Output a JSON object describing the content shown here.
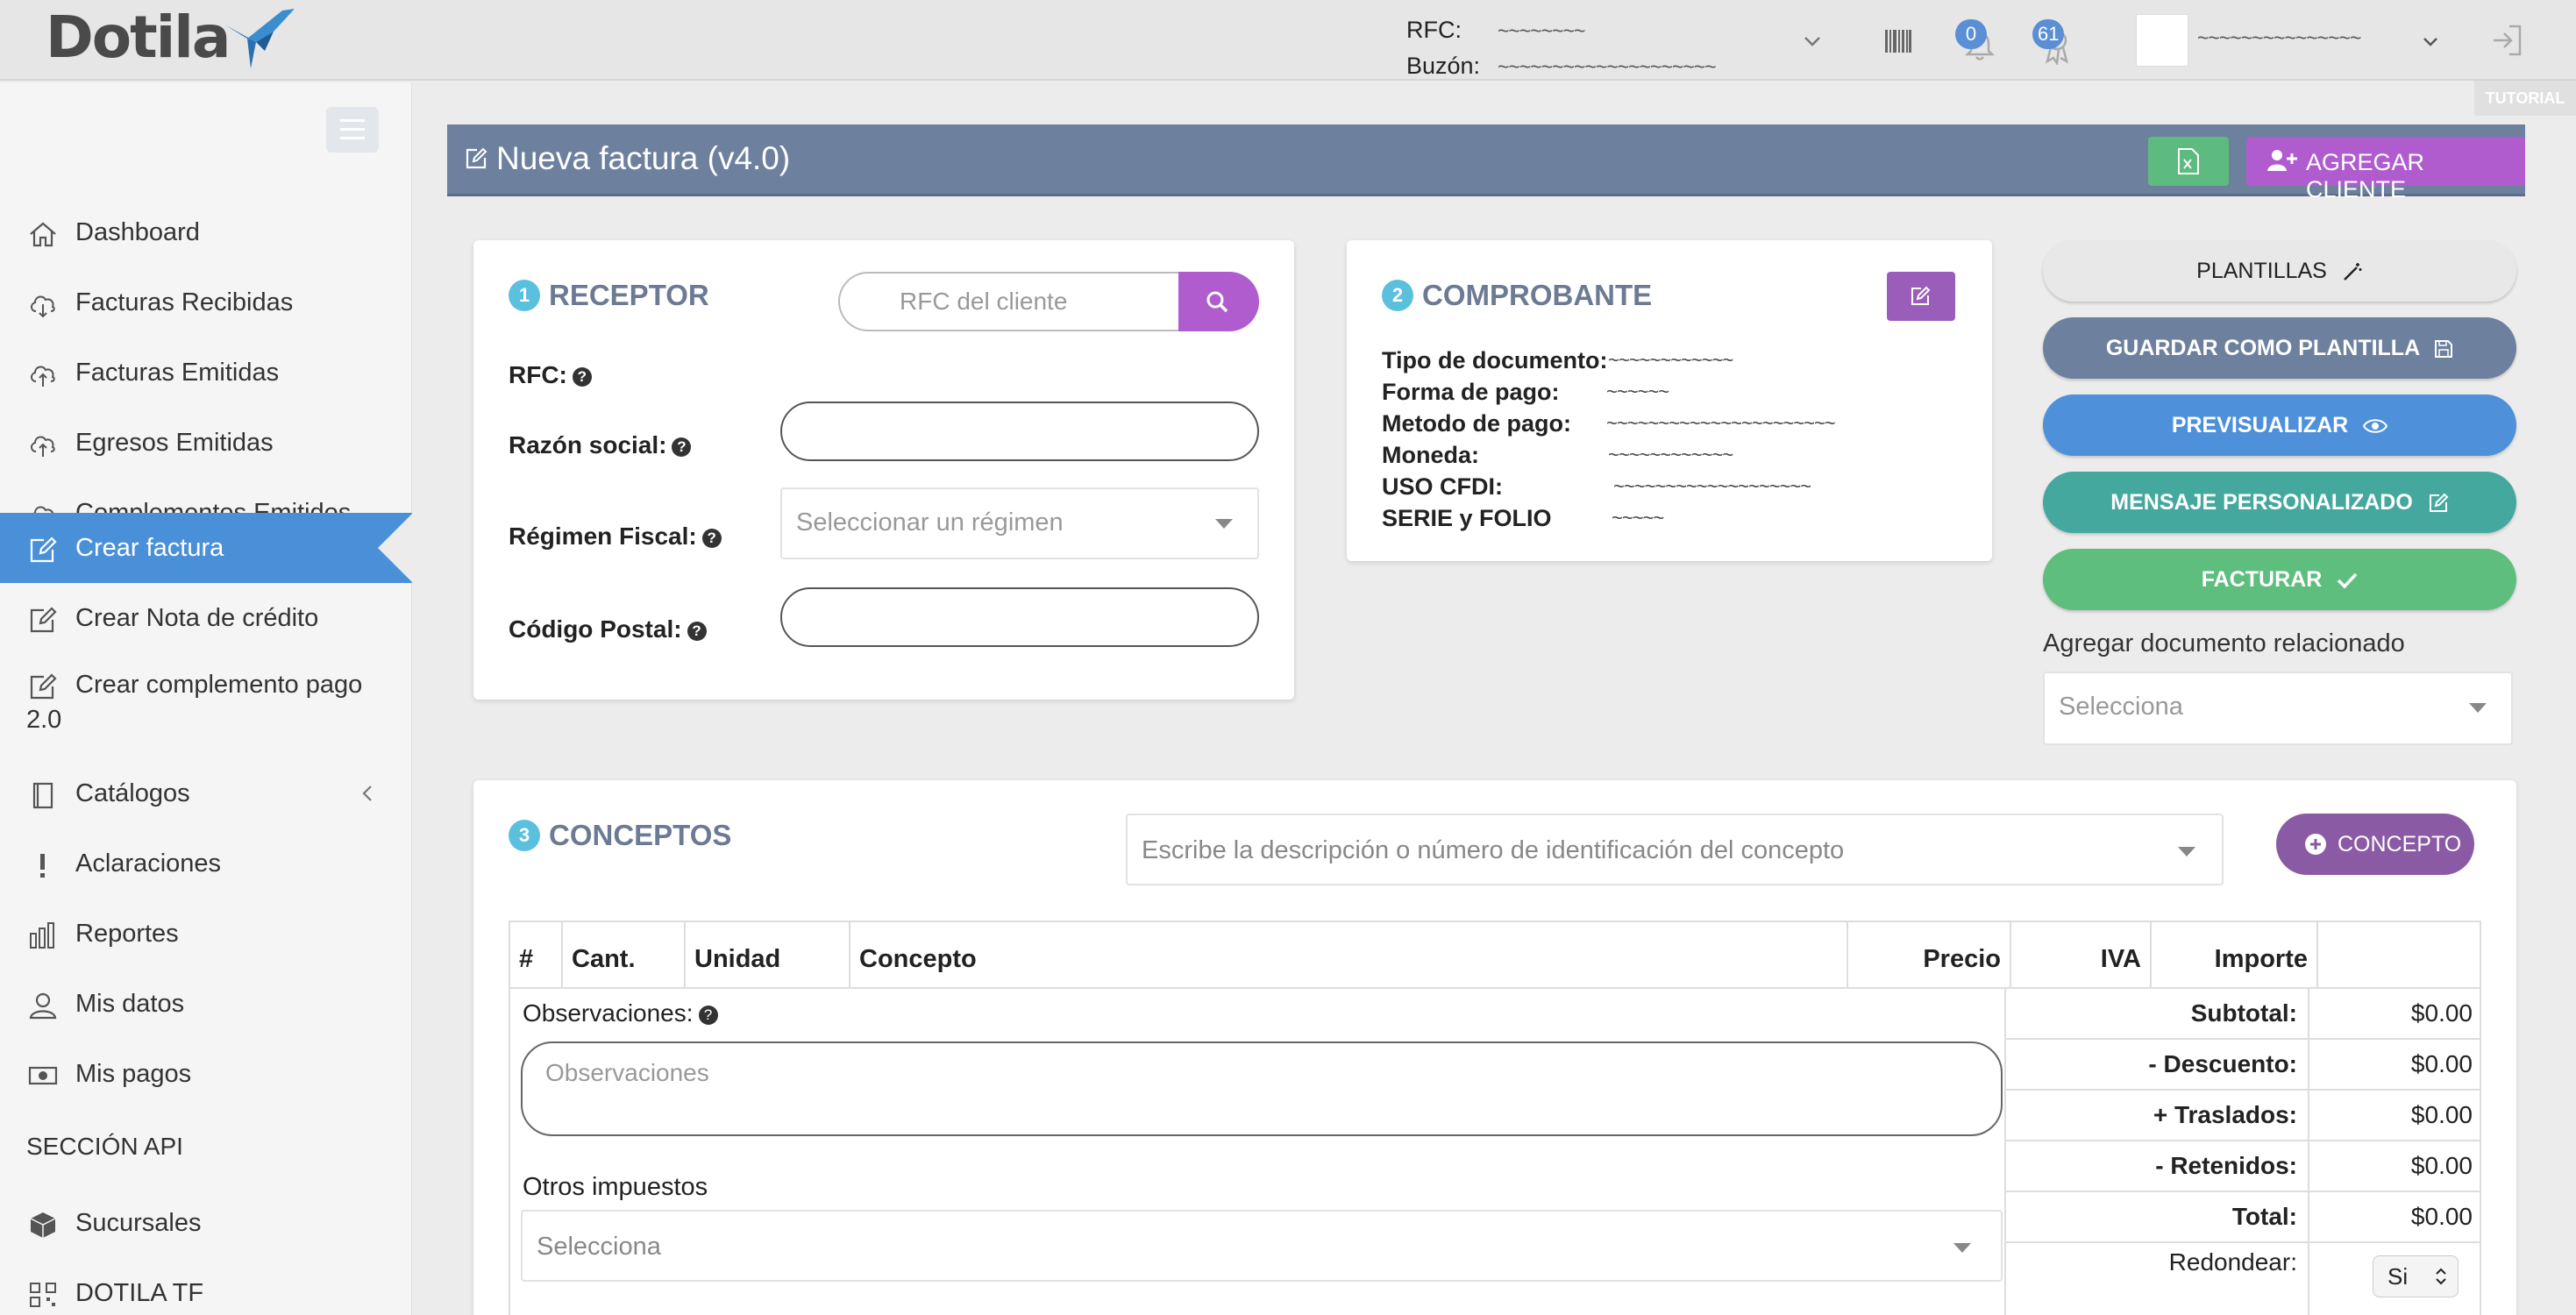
{
  "app": {
    "logo": "Dotila"
  },
  "topbar": {
    "rfc_label": "RFC:",
    "rfc_value": "~~~~~~~~",
    "buzon_label": "Buzón:",
    "buzon_value": "~~~~~~~~~~~~~~~~~~~~",
    "notifications_count": "0",
    "awards_count": "61",
    "user_name": "~~~~~~~~~~~~~~~",
    "tutorial": "TUTORIAL"
  },
  "sidebar": {
    "items": [
      {
        "label": "Dashboard",
        "icon": "home-icon"
      },
      {
        "label": "Facturas Recibidas",
        "icon": "cloud-download-icon"
      },
      {
        "label": "Facturas Emitidas",
        "icon": "cloud-upload-icon"
      },
      {
        "label": "Egresos Emitidas",
        "icon": "cloud-upload-icon"
      },
      {
        "label": "Complementos Emitidos",
        "icon": "cloud-upload-icon"
      },
      {
        "label": "Crear factura",
        "icon": "edit-icon"
      },
      {
        "label": "Crear Nota de crédito",
        "icon": "edit-icon"
      },
      {
        "label": "Crear complemento pago",
        "label2": "2.0",
        "icon": "edit-icon"
      },
      {
        "label": "Catálogos",
        "icon": "book-icon"
      },
      {
        "label": "Aclaraciones",
        "icon": "exclamation-icon"
      },
      {
        "label": "Reportes",
        "icon": "bar-chart-icon"
      },
      {
        "label": "Mis datos",
        "icon": "user-icon"
      },
      {
        "label": "Mis pagos",
        "icon": "money-icon"
      }
    ],
    "section_api": "SECCIÓN API",
    "api_items": [
      {
        "label": "Sucursales",
        "icon": "cube-icon"
      },
      {
        "label": "DOTILA TF",
        "icon": "qr-icon"
      }
    ]
  },
  "header": {
    "title": "Nueva factura (v4.0)",
    "add_client": "AGREGAR CLIENTE"
  },
  "receptor": {
    "step": "1",
    "title": "RECEPTOR",
    "rfc_placeholder": "RFC del cliente",
    "rfc_label": "RFC:",
    "razon_label": "Razón social:",
    "regimen_label": "Régimen Fiscal:",
    "regimen_placeholder": "Seleccionar un régimen",
    "cp_label": "Código Postal:",
    "help": "?"
  },
  "comprobante": {
    "step": "2",
    "title": "COMPROBANTE",
    "rows": [
      {
        "label": "Tipo de documento:",
        "value": "~~~~~~~~~~~~"
      },
      {
        "label": "Forma de pago:",
        "value": "~~~~~~"
      },
      {
        "label": "Metodo de pago:",
        "value": "~~~~~~~~~~~~~~~~~~~~~~"
      },
      {
        "label": "Moneda:",
        "value": "~~~~~~~~~~~~"
      },
      {
        "label": "USO CFDI:",
        "value": "~~~~~~~~~~~~~~~~~~~"
      },
      {
        "label": "SERIE y FOLIO",
        "value": "~~~~~"
      }
    ]
  },
  "actions": {
    "plantillas": "PLANTILLAS",
    "guardar": "GUARDAR COMO PLANTILLA",
    "previsualizar": "PREVISUALIZAR",
    "mensaje": "MENSAJE PERSONALIZADO",
    "facturar": "FACTURAR",
    "related_label": "Agregar documento relacionado",
    "related_placeholder": "Selecciona"
  },
  "conceptos": {
    "step": "3",
    "title": "CONCEPTOS",
    "search_placeholder": "Escribe la descripción o número de identificación del concepto",
    "add_button": "CONCEPTO",
    "columns": [
      "#",
      "Cant.",
      "Unidad",
      "Concepto",
      "Precio",
      "IVA",
      "Importe"
    ],
    "obs_label": "Observaciones:",
    "obs_placeholder": "Observaciones",
    "otros_label": "Otros impuestos",
    "otros_placeholder": "Selecciona",
    "totals": [
      {
        "label": "Subtotal:",
        "value": "$0.00"
      },
      {
        "label": "- Descuento:",
        "value": "$0.00"
      },
      {
        "label": "+ Traslados:",
        "value": "$0.00"
      },
      {
        "label": "- Retenidos:",
        "value": "$0.00"
      },
      {
        "label": "Total:",
        "value": "$0.00"
      }
    ],
    "redondear_label": "Redondear:",
    "redondear_value": "Si"
  }
}
